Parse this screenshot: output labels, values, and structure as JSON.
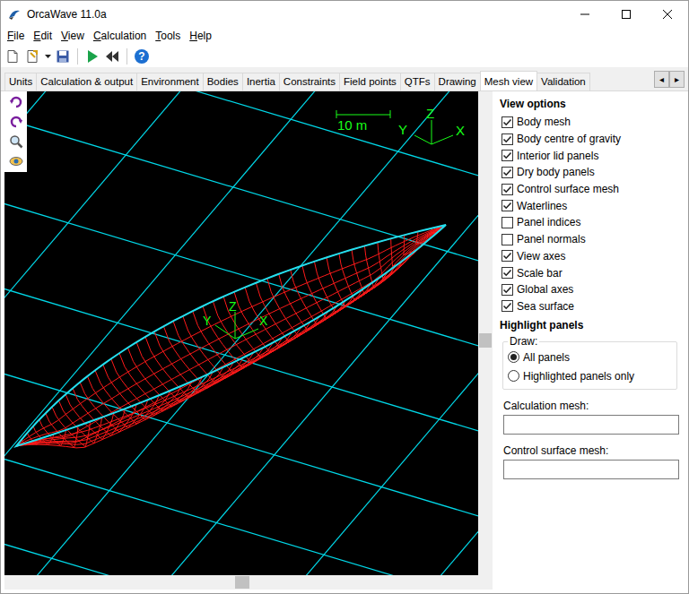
{
  "window": {
    "title": "OrcaWave 11.0a"
  },
  "menu": [
    {
      "label": "File",
      "underline": 0
    },
    {
      "label": "Edit",
      "underline": 0
    },
    {
      "label": "View",
      "underline": 0
    },
    {
      "label": "Calculation",
      "underline": 0
    },
    {
      "label": "Tools",
      "underline": 0
    },
    {
      "label": "Help",
      "underline": 0
    }
  ],
  "toolbar": {
    "help": "?"
  },
  "tabs": [
    {
      "label": "Units",
      "selected": false
    },
    {
      "label": "Calculation & output",
      "selected": false
    },
    {
      "label": "Environment",
      "selected": false
    },
    {
      "label": "Bodies",
      "selected": false
    },
    {
      "label": "Inertia",
      "selected": false
    },
    {
      "label": "Constraints",
      "selected": false
    },
    {
      "label": "Field points",
      "selected": false
    },
    {
      "label": "QTFs",
      "selected": false
    },
    {
      "label": "Drawing",
      "selected": false
    },
    {
      "label": "Mesh view",
      "selected": true
    },
    {
      "label": "Validation",
      "selected": false
    }
  ],
  "tab_scroll": [
    "◂",
    "▸"
  ],
  "view": {
    "scale_bar": "10 m",
    "global_axes": {
      "x": "X",
      "y": "Y",
      "z": "Z"
    },
    "body_axes": {
      "x": "X",
      "y": "Y",
      "z": "Z"
    }
  },
  "view_options": {
    "title": "View options",
    "items": [
      {
        "label": "Body mesh",
        "checked": true
      },
      {
        "label": "Body centre of gravity",
        "checked": true
      },
      {
        "label": "Interior lid panels",
        "checked": true
      },
      {
        "label": "Dry body panels",
        "checked": true
      },
      {
        "label": "Control surface mesh",
        "checked": true
      },
      {
        "label": "Waterlines",
        "checked": true
      },
      {
        "label": "Panel indices",
        "checked": false
      },
      {
        "label": "Panel normals",
        "checked": false
      },
      {
        "label": "View axes",
        "checked": true
      },
      {
        "label": "Scale bar",
        "checked": true
      },
      {
        "label": "Global axes",
        "checked": true
      },
      {
        "label": "Sea surface",
        "checked": true
      }
    ]
  },
  "highlight": {
    "title": "Highlight panels",
    "group": "Draw:",
    "options": [
      {
        "label": "All panels",
        "selected": true
      },
      {
        "label": "Highlighted panels only",
        "selected": false
      }
    ]
  },
  "fields": [
    {
      "label": "Calculation mesh:",
      "value": ""
    },
    {
      "label": "Control surface mesh:",
      "value": ""
    }
  ]
}
